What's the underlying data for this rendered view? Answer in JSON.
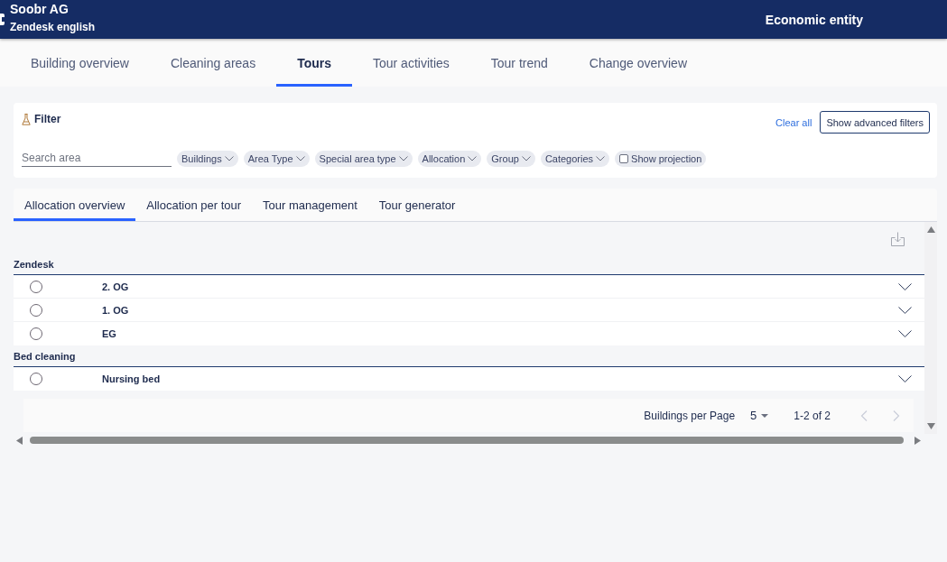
{
  "header": {
    "company": "Soobr AG",
    "workspace": "Zendesk english",
    "context": "Economic entity"
  },
  "nav_tabs": [
    {
      "label": "Building overview",
      "selected": false
    },
    {
      "label": "Cleaning areas",
      "selected": false
    },
    {
      "label": "Tours",
      "selected": true
    },
    {
      "label": "Tour activities",
      "selected": false
    },
    {
      "label": "Tour trend",
      "selected": false
    },
    {
      "label": "Change overview",
      "selected": false
    }
  ],
  "filter": {
    "title": "Filter",
    "clear_all": "Clear all",
    "advanced_button": "Show advanced filters",
    "search": {
      "placeholder": "Search area"
    },
    "chips": [
      {
        "kind": "dropdown",
        "label": "Buildings"
      },
      {
        "kind": "dropdown",
        "label": "Area Type"
      },
      {
        "kind": "dropdown",
        "label": "Special area type"
      },
      {
        "kind": "dropdown",
        "label": "Allocation"
      },
      {
        "kind": "dropdown",
        "label": "Group"
      },
      {
        "kind": "dropdown",
        "label": "Categories"
      },
      {
        "kind": "checkbox",
        "label": "Show projection",
        "checked": false
      }
    ]
  },
  "sub_tabs": [
    {
      "label": "Allocation overview",
      "selected": true
    },
    {
      "label": "Allocation per tour",
      "selected": false
    },
    {
      "label": "Tour management",
      "selected": false
    },
    {
      "label": "Tour generator",
      "selected": false
    }
  ],
  "allocation_groups": [
    {
      "name": "Zendesk",
      "rows": [
        {
          "label": "2. OG",
          "selected": false,
          "expanded": false
        },
        {
          "label": "1. OG",
          "selected": false,
          "expanded": false
        },
        {
          "label": "EG",
          "selected": false,
          "expanded": false
        }
      ]
    },
    {
      "name": "Bed cleaning",
      "rows": [
        {
          "label": "Nursing bed",
          "selected": false,
          "expanded": false
        }
      ]
    }
  ],
  "pagination": {
    "per_page_label": "Buildings per Page",
    "per_page": "5",
    "range": "1-2 of 2",
    "previous": {
      "disabled": true
    },
    "next": {
      "disabled": true
    }
  }
}
